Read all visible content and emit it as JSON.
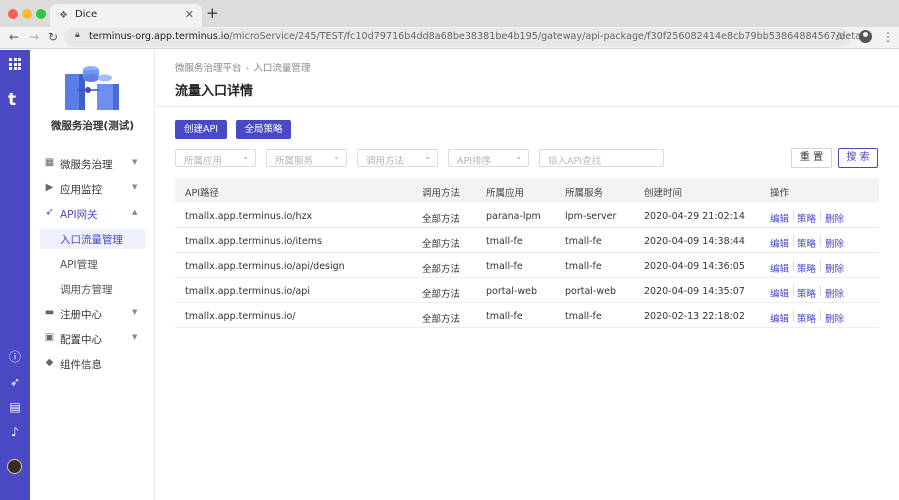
{
  "browser": {
    "tab_title": "Dice",
    "url_host": "terminus-org.app.terminus.io",
    "url_path": "/microService/245/TEST/fc10d79716b4dd8a68be38381be4b195/gateway/api-package/f30f256082414e8cb79bb53864884567/detail",
    "colors": {
      "close": "#fc5f57",
      "minimize": "#fdbc2e",
      "maximize": "#28c840"
    }
  },
  "rail": {
    "accent": "#4a49c4",
    "icons": [
      "apps-grid-icon",
      "brand-t-icon",
      "help-icon",
      "rocket-icon",
      "document-icon",
      "bell-icon",
      "user-avatar"
    ]
  },
  "sidebar": {
    "system_name": "微服务治理(测试)",
    "menu": [
      {
        "label": "微服务治理",
        "icon": "cube-icon",
        "arrow": "down"
      },
      {
        "label": "应用监控",
        "icon": "video-icon",
        "arrow": "down"
      },
      {
        "label": "API网关",
        "icon": "rocket-icon",
        "arrow": "up",
        "active": true,
        "children": [
          {
            "label": "入口流量管理",
            "active": true
          },
          {
            "label": "API管理"
          },
          {
            "label": "调用方管理"
          }
        ]
      },
      {
        "label": "注册中心",
        "icon": "register-icon",
        "arrow": "down"
      },
      {
        "label": "配置中心",
        "icon": "config-icon",
        "arrow": "down"
      },
      {
        "label": "组件信息",
        "icon": "tag-icon"
      }
    ]
  },
  "main": {
    "breadcrumb": [
      "微服务治理平台",
      "入口流量管理"
    ],
    "title": "流量入口详情",
    "buttons": {
      "create_api": "创建API",
      "global_policy": "全局策略",
      "reset": "重 置",
      "search": "搜 索"
    },
    "filters": {
      "app": "所属应用",
      "service": "所属服务",
      "method": "调用方法",
      "sort": "API排序",
      "search_placeholder": "输入API查找"
    },
    "table": {
      "headers": [
        "API路径",
        "调用方法",
        "所属应用",
        "所属服务",
        "创建时间",
        "操作"
      ],
      "actions": [
        "编辑",
        "策略",
        "删除"
      ],
      "rows": [
        [
          "tmallx.app.terminus.io/hzx",
          "全部方法",
          "parana-lpm",
          "lpm-server",
          "2020-04-29 21:02:14"
        ],
        [
          "tmallx.app.terminus.io/items",
          "全部方法",
          "tmall-fe",
          "tmall-fe",
          "2020-04-09 14:38:44"
        ],
        [
          "tmallx.app.terminus.io/api/design",
          "全部方法",
          "tmall-fe",
          "tmall-fe",
          "2020-04-09 14:36:05"
        ],
        [
          "tmallx.app.terminus.io/api",
          "全部方法",
          "portal-web",
          "portal-web",
          "2020-04-09 14:35:07"
        ],
        [
          "tmallx.app.terminus.io/",
          "全部方法",
          "tmall-fe",
          "tmall-fe",
          "2020-02-13 22:18:02"
        ]
      ]
    }
  }
}
